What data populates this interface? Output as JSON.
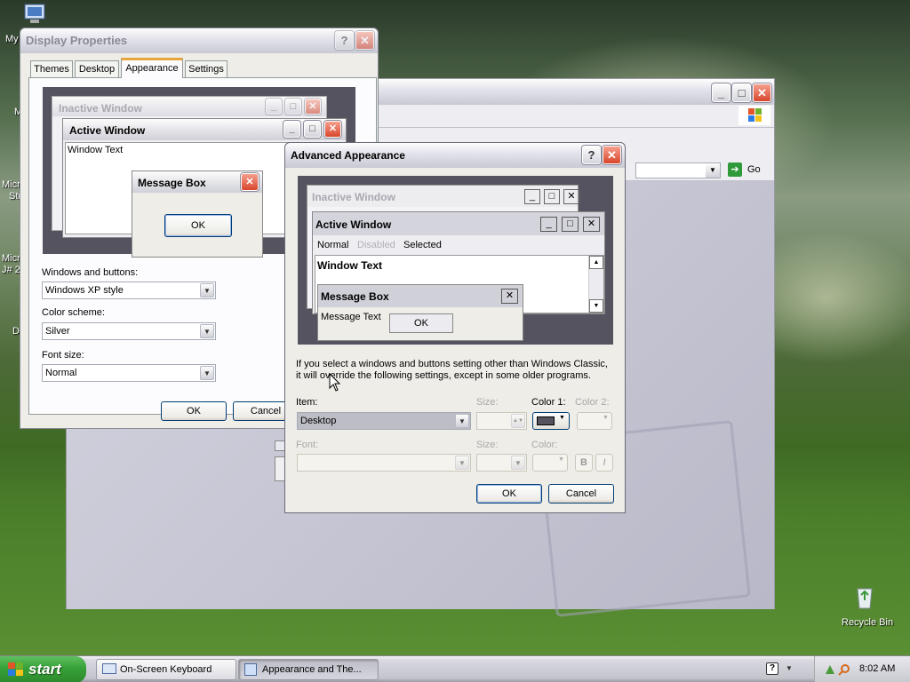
{
  "desktop": {
    "icons": [
      {
        "label": "My"
      },
      {
        "label": "Recycle Bin"
      }
    ],
    "truncated_labels": [
      "M",
      "Micro",
      "Stu",
      "Micro",
      "J# 2",
      "D"
    ]
  },
  "bg_window": {
    "go_label": "Go"
  },
  "display_props": {
    "title": "Display Properties",
    "tabs": [
      "Themes",
      "Desktop",
      "Appearance",
      "Settings"
    ],
    "preview": {
      "inactive_title": "Inactive Window",
      "active_title": "Active Window",
      "window_text": "Window Text",
      "msgbox_title": "Message Box",
      "msgbox_ok": "OK"
    },
    "windows_buttons_label": "Windows and buttons:",
    "windows_buttons_value": "Windows XP style",
    "color_scheme_label": "Color scheme:",
    "color_scheme_value": "Silver",
    "font_size_label": "Font size:",
    "font_size_value": "Normal",
    "ok": "OK",
    "cancel": "Cancel"
  },
  "advanced": {
    "title": "Advanced Appearance",
    "preview": {
      "inactive_title": "Inactive Window",
      "active_title": "Active Window",
      "menu_normal": "Normal",
      "menu_disabled": "Disabled",
      "menu_selected": "Selected",
      "window_text": "Window Text",
      "msgbox_title": "Message Box",
      "msgbox_text": "Message Text",
      "msgbox_ok": "OK"
    },
    "info_line1": "If you select a windows and buttons setting other than Windows Classic,",
    "info_line2": "it will override the following settings, except in some older programs.",
    "item_label": "Item:",
    "item_value": "Desktop",
    "size_label": "Size:",
    "color1_label": "Color 1:",
    "color2_label": "Color 2:",
    "font_label": "Font:",
    "font_size_label": "Size:",
    "font_color_label": "Color:",
    "bold_label": "B",
    "italic_label": "I",
    "ok": "OK",
    "cancel": "Cancel",
    "color1_hex": "#55535f"
  },
  "taskbar": {
    "start": "start",
    "tasks": [
      {
        "label": "On-Screen Keyboard"
      },
      {
        "label": "Appearance and The..."
      }
    ],
    "clock": "8:02 AM"
  }
}
